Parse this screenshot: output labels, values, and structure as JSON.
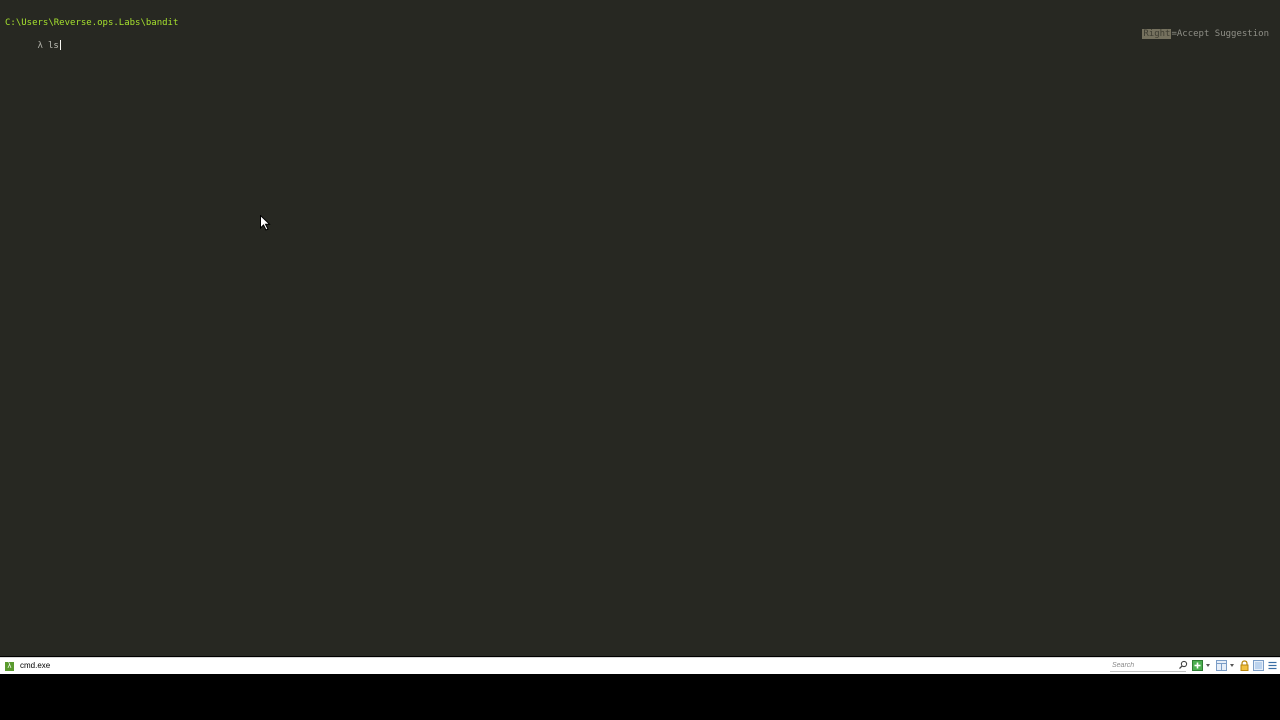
{
  "terminal": {
    "cwd": "C:\\Users\\Reverse.ops.Labs\\bandit",
    "prompt_symbol": "λ",
    "command_input": "ls",
    "hint_key": "Right",
    "hint_text": "=Accept Suggestion",
    "colors": {
      "background": "#272822",
      "cwd": "#a6e22e"
    }
  },
  "statusbar": {
    "tab_icon": "lambda-icon",
    "tab_label": "cmd.exe",
    "search_placeholder": "Search",
    "icons": [
      "search-icon",
      "new-console-icon",
      "split-view-icon",
      "lock-icon",
      "layout-icon",
      "menu-icon"
    ]
  }
}
